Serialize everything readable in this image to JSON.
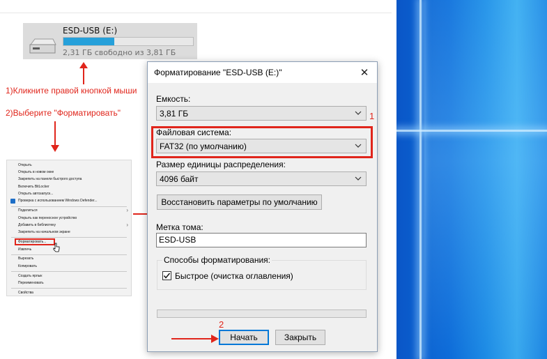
{
  "drive": {
    "name": "ESD-USB (E:)",
    "free_text": "2,31 ГБ свободно из 3,81 ГБ",
    "used_fraction": 0.39
  },
  "annotations": {
    "step1": "1)Кликните правой кнопкой мыши",
    "step2": "2)Выберите \"Форматировать\"",
    "num1": "1",
    "num2": "2"
  },
  "context_menu": {
    "items": [
      "Открыть",
      "Открыть в новом окне",
      "Закрепить на панели быстрого доступа",
      "Включить BitLocker",
      "Открыть автозапуск...",
      "Проверка с использованием Windows Defender...",
      "Поделиться",
      "Открыть как переносное устройство",
      "Добавить в библиотеку",
      "Закрепить на начальном экране",
      "Форматировать...",
      "Извлечь",
      "Вырезать",
      "Копировать",
      "Создать ярлык",
      "Переименовать",
      "Свойства"
    ]
  },
  "dialog": {
    "title": "Форматирование \"ESD-USB (E:)\"",
    "capacity_label": "Емкость:",
    "capacity_value": "3,81 ГБ",
    "filesystem_label": "Файловая система:",
    "filesystem_value": "FAT32 (по умолчанию)",
    "alloc_label": "Размер единицы распределения:",
    "alloc_value": "4096 байт",
    "restore_button": "Восстановить параметры по умолчанию",
    "volume_label": "Метка тома:",
    "volume_value": "ESD-USB",
    "format_options_title": "Способы форматирования:",
    "quick_format_label": "Быстрое (очистка оглавления)",
    "quick_format_checked": true,
    "progress": 0,
    "start_button": "Начать",
    "close_button": "Закрыть"
  },
  "colors": {
    "annotation_red": "#e0251b",
    "drive_bar": "#26a0da",
    "focus_blue": "#0078d7"
  }
}
